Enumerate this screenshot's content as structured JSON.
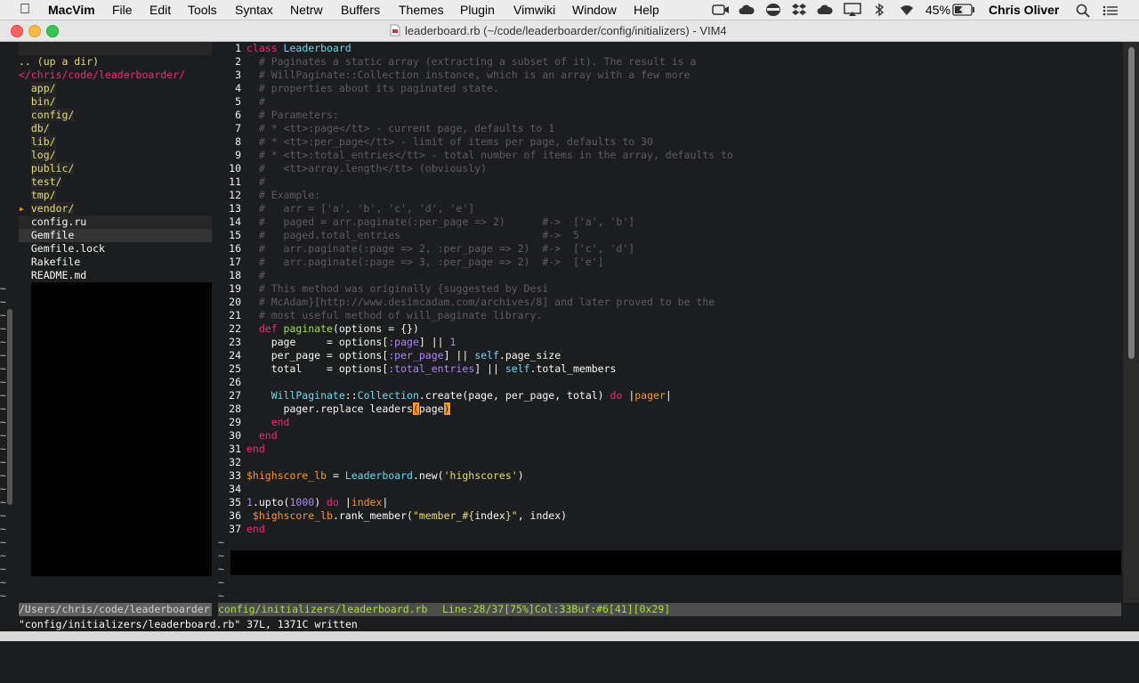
{
  "menubar": {
    "app_name": "MacVim",
    "items": [
      "File",
      "Edit",
      "Tools",
      "Syntax",
      "Netrw",
      "Buffers",
      "Themes",
      "Plugin",
      "Vimwiki",
      "Window",
      "Help"
    ],
    "battery": "45%",
    "user": "Chris Oliver"
  },
  "window": {
    "title": "leaderboard.rb (~/code/leaderboarder/config/initializers) - VIM4"
  },
  "nerdtree": {
    "up_dir": ".. (up a dir)",
    "root": "</chris/code/leaderboarder/",
    "entries": [
      {
        "label": "app/",
        "type": "dir"
      },
      {
        "label": "bin/",
        "type": "dir"
      },
      {
        "label": "config/",
        "type": "dir"
      },
      {
        "label": "db/",
        "type": "dir"
      },
      {
        "label": "lib/",
        "type": "dir"
      },
      {
        "label": "log/",
        "type": "dir"
      },
      {
        "label": "public/",
        "type": "dir"
      },
      {
        "label": "test/",
        "type": "dir"
      },
      {
        "label": "tmp/",
        "type": "dir"
      },
      {
        "label": "vendor/",
        "type": "dir",
        "marker": "▸"
      },
      {
        "label": "config.ru",
        "type": "file"
      },
      {
        "label": "Gemfile",
        "type": "file"
      },
      {
        "label": "Gemfile.lock",
        "type": "file"
      },
      {
        "label": "Rakefile",
        "type": "file"
      },
      {
        "label": "README.md",
        "type": "file"
      }
    ],
    "tilde": "~"
  },
  "code": {
    "lines": [
      [
        [
          "kw",
          "class "
        ],
        [
          "cn",
          "Leaderboard"
        ]
      ],
      [
        [
          "cm",
          "  # Paginates a static array (extracting a subset of it). The result is a"
        ]
      ],
      [
        [
          "cm",
          "  # WillPaginate::Collection instance, which is an array with a few more"
        ]
      ],
      [
        [
          "cm",
          "  # properties about its paginated state."
        ]
      ],
      [
        [
          "cm",
          "  #"
        ]
      ],
      [
        [
          "cm",
          "  # Parameters:"
        ]
      ],
      [
        [
          "cm",
          "  # * <tt>:page</tt> - current page, defaults to 1"
        ]
      ],
      [
        [
          "cm",
          "  # * <tt>:per_page</tt> - limit of items per page, defaults to 30"
        ]
      ],
      [
        [
          "cm",
          "  # * <tt>:total_entries</tt> - total number of items in the array, defaults to"
        ]
      ],
      [
        [
          "cm",
          "  #   <tt>array.length</tt> (obviously)"
        ]
      ],
      [
        [
          "cm",
          "  #"
        ]
      ],
      [
        [
          "cm",
          "  # Example:"
        ]
      ],
      [
        [
          "cm",
          "  #   arr = ['a', 'b', 'c', 'd', 'e']"
        ]
      ],
      [
        [
          "cm",
          "  #   paged = arr.paginate(:per_page => 2)      #->  ['a', 'b']"
        ]
      ],
      [
        [
          "cm",
          "  #   paged.total_entries                       #->  5"
        ]
      ],
      [
        [
          "cm",
          "  #   arr.paginate(:page => 2, :per_page => 2)  #->  ['c', 'd']"
        ]
      ],
      [
        [
          "cm",
          "  #   arr.paginate(:page => 3, :per_page => 2)  #->  ['e']"
        ]
      ],
      [
        [
          "cm",
          "  #"
        ]
      ],
      [
        [
          "cm",
          "  # This method was originally {suggested by Desi"
        ]
      ],
      [
        [
          "cm",
          "  # McAdam}[http://www.desimcadam.com/archives/8] and later proved to be the"
        ]
      ],
      [
        [
          "cm",
          "  # most useful method of will_paginate library."
        ]
      ],
      [
        [
          "kw",
          "  def "
        ],
        [
          "fn",
          "paginate"
        ],
        [
          "pl",
          "(options = {})"
        ]
      ],
      [
        [
          "pl",
          "    page     = options["
        ],
        [
          "sym",
          ":page"
        ],
        [
          "pl",
          "] || "
        ],
        [
          "num",
          "1"
        ]
      ],
      [
        [
          "pl",
          "    per_page = options["
        ],
        [
          "sym",
          ":per_page"
        ],
        [
          "pl",
          "] || "
        ],
        [
          "cn",
          "self"
        ],
        [
          "pl",
          ".page_size"
        ]
      ],
      [
        [
          "pl",
          "    total    = options["
        ],
        [
          "sym",
          ":total_entries"
        ],
        [
          "pl",
          "] || "
        ],
        [
          "cn",
          "self"
        ],
        [
          "pl",
          ".total_members"
        ]
      ],
      [
        [
          "pl",
          ""
        ]
      ],
      [
        [
          "cn",
          "    WillPaginate"
        ],
        [
          "pl",
          "::"
        ],
        [
          "cn",
          "Collection"
        ],
        [
          "pl",
          ".create(page, per_page, total) "
        ],
        [
          "kw",
          "do"
        ],
        [
          "pl",
          " |"
        ],
        [
          "gv",
          "pager"
        ],
        [
          "pl",
          "|"
        ]
      ],
      [
        [
          "pl",
          "      pager.replace leaders"
        ],
        [
          "mp",
          "("
        ],
        [
          "pl",
          "page"
        ],
        [
          "mp",
          ")"
        ]
      ],
      [
        [
          "kw",
          "    end"
        ]
      ],
      [
        [
          "kw",
          "  end"
        ]
      ],
      [
        [
          "kw",
          "end"
        ]
      ],
      [
        [
          "pl",
          ""
        ]
      ],
      [
        [
          "gv",
          "$highscore_lb"
        ],
        [
          "pl",
          " = "
        ],
        [
          "cn",
          "Leaderboard"
        ],
        [
          "pl",
          ".new("
        ],
        [
          "str",
          "'highscores'"
        ],
        [
          "pl",
          ")"
        ]
      ],
      [
        [
          "pl",
          ""
        ]
      ],
      [
        [
          "num",
          "1"
        ],
        [
          "pl",
          ".upto("
        ],
        [
          "num",
          "1000"
        ],
        [
          "pl",
          ") "
        ],
        [
          "kw",
          "do"
        ],
        [
          "pl",
          " |"
        ],
        [
          "gv",
          "index"
        ],
        [
          "pl",
          "|"
        ]
      ],
      [
        [
          "gv",
          " $highscore_lb"
        ],
        [
          "pl",
          ".rank_member("
        ],
        [
          "str",
          "\"member_#{"
        ],
        [
          "pl",
          "index"
        ],
        [
          "str",
          "}\""
        ],
        [
          "pl",
          ", index)"
        ]
      ],
      [
        [
          "kw",
          "end"
        ]
      ]
    ]
  },
  "statusline": {
    "left": "/Users/chris/code/leaderboarder",
    "file": "config/initializers/leaderboard.rb",
    "info": "Line:28/37[75%]Col:33Buf:#6[41][0x29]"
  },
  "cmdline": "\"config/initializers/leaderboard.rb\" 37L, 1371C written",
  "colors": {
    "background": "#1b1d1e",
    "dir": "#e6db74",
    "root": "#f92672",
    "status_file": "#a6e22e"
  }
}
